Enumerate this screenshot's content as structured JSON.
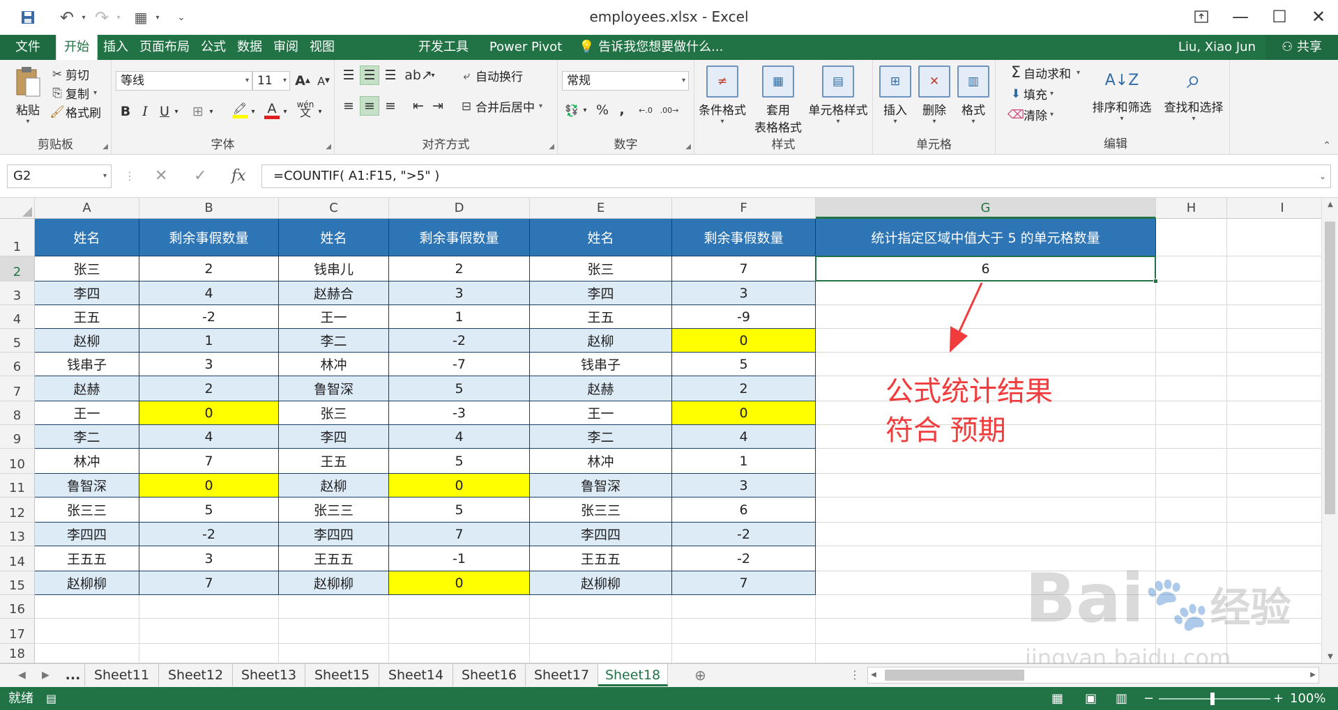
{
  "window": {
    "title": "employees.xlsx - Excel"
  },
  "ribbon_tabs": [
    "文件",
    "开始",
    "插入",
    "页面布局",
    "公式",
    "数据",
    "审阅",
    "视图",
    "开发工具",
    "Power Pivot"
  ],
  "active_tab": "开始",
  "tell_me": "告诉我您想要做什么...",
  "user": "Liu, Xiao Jun",
  "share": "共享",
  "clipboard": {
    "paste": "粘贴",
    "cut": "剪切",
    "copy": "复制",
    "format_painter": "格式刷",
    "label": "剪贴板"
  },
  "font": {
    "name": "等线",
    "size": "11",
    "label": "字体"
  },
  "alignment": {
    "wrap": "自动换行",
    "merge": "合并后居中",
    "label": "对齐方式"
  },
  "number": {
    "format": "常规",
    "label": "数字"
  },
  "styles": {
    "conditional": "条件格式",
    "table_1": "套用",
    "table_2": "表格格式",
    "cell_styles": "单元格样式",
    "label": "样式"
  },
  "cells": {
    "insert": "插入",
    "delete": "删除",
    "format": "格式",
    "label": "单元格"
  },
  "editing": {
    "autosum": "自动求和",
    "fill": "填充",
    "clear": "清除",
    "sort": "排序和筛选",
    "find": "查找和选择",
    "label": "编辑"
  },
  "formula_bar": {
    "name_box": "G2",
    "formula": "=COUNTIF( A1:F15, \">5\" )"
  },
  "columns": [
    "A",
    "B",
    "C",
    "D",
    "E",
    "F",
    "G",
    "H",
    "I"
  ],
  "rows": [
    "1",
    "2",
    "3",
    "4",
    "5",
    "6",
    "7",
    "8",
    "9",
    "10",
    "11",
    "12",
    "13",
    "14",
    "15",
    "16",
    "17",
    "18"
  ],
  "table": {
    "headers": [
      "姓名",
      "剩余事假数量",
      "姓名",
      "剩余事假数量",
      "姓名",
      "剩余事假数量",
      "统计指定区域中值大于 5 的单元格数量"
    ],
    "rows": [
      [
        "张三",
        "2",
        "钱串儿",
        "2",
        "张三",
        "7",
        "6"
      ],
      [
        "李四",
        "4",
        "赵赫合",
        "3",
        "李四",
        "3",
        ""
      ],
      [
        "王五",
        "-2",
        "王一",
        "1",
        "王五",
        "-9",
        ""
      ],
      [
        "赵柳",
        "1",
        "李二",
        "-2",
        "赵柳",
        "0",
        ""
      ],
      [
        "钱串子",
        "3",
        "林冲",
        "-7",
        "钱串子",
        "5",
        ""
      ],
      [
        "赵赫",
        "2",
        "鲁智深",
        "5",
        "赵赫",
        "2",
        ""
      ],
      [
        "王一",
        "0",
        "张三",
        "-3",
        "王一",
        "0",
        ""
      ],
      [
        "李二",
        "4",
        "李四",
        "4",
        "李二",
        "4",
        ""
      ],
      [
        "林冲",
        "7",
        "王五",
        "5",
        "林冲",
        "1",
        ""
      ],
      [
        "鲁智深",
        "0",
        "赵柳",
        "0",
        "鲁智深",
        "3",
        ""
      ],
      [
        "张三三",
        "5",
        "张三三",
        "5",
        "张三三",
        "6",
        ""
      ],
      [
        "李四四",
        "-2",
        "李四四",
        "7",
        "李四四",
        "-2",
        ""
      ],
      [
        "王五五",
        "3",
        "王五五",
        "-1",
        "王五五",
        "-2",
        ""
      ],
      [
        "赵柳柳",
        "7",
        "赵柳柳",
        "0",
        "赵柳柳",
        "7",
        ""
      ]
    ],
    "highlight_color": "#ffff00",
    "header_color": "#2e75b6",
    "band_color": "#ddebf7"
  },
  "annotation": {
    "line1": "公式统计结果",
    "line2": "符合 预期"
  },
  "sheet_tabs": [
    "...",
    "Sheet11",
    "Sheet12",
    "Sheet13",
    "Sheet15",
    "Sheet14",
    "Sheet16",
    "Sheet17",
    "Sheet18"
  ],
  "active_sheet": "Sheet18",
  "status": {
    "ready": "就绪",
    "zoom": "100%"
  },
  "watermark": {
    "brand": "Bai",
    "brand2": "经验",
    "url": "jingyan.baidu.com"
  }
}
